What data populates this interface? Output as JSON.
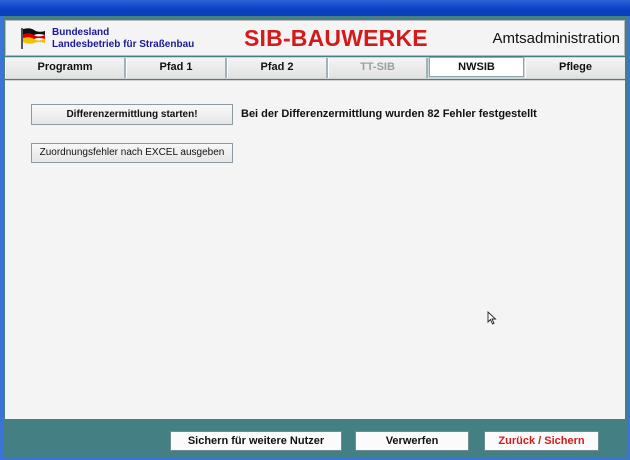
{
  "header": {
    "org_line1": "Bundesland",
    "org_line2": "Landesbetrieb für Straßenbau",
    "app_title": "SIB-BAUWERKE",
    "role": "Amtsadministration",
    "flag_icon": "flag-icon"
  },
  "tabs": [
    {
      "label": "Programm",
      "state": "normal"
    },
    {
      "label": "Pfad 1",
      "state": "normal"
    },
    {
      "label": "Pfad 2",
      "state": "normal"
    },
    {
      "label": "TT-SIB",
      "state": "disabled"
    },
    {
      "label": "NWSIB",
      "state": "active"
    },
    {
      "label": "Pflege",
      "state": "normal"
    }
  ],
  "main": {
    "start_button": "Differenzermittlung starten!",
    "result_text": "Bei der Differenzermittlung wurden 82 Fehler festgestellt",
    "export_button": "Zuordnungsfehler nach EXCEL ausgeben"
  },
  "footer": {
    "save_others": "Sichern für weitere Nutzer",
    "discard": "Verwerfen",
    "back_save": "Zurück / Sichern"
  },
  "colors": {
    "accent_red": "#d41a1a",
    "org_blue": "#1a1a9c",
    "frame_teal": "#447f84"
  }
}
